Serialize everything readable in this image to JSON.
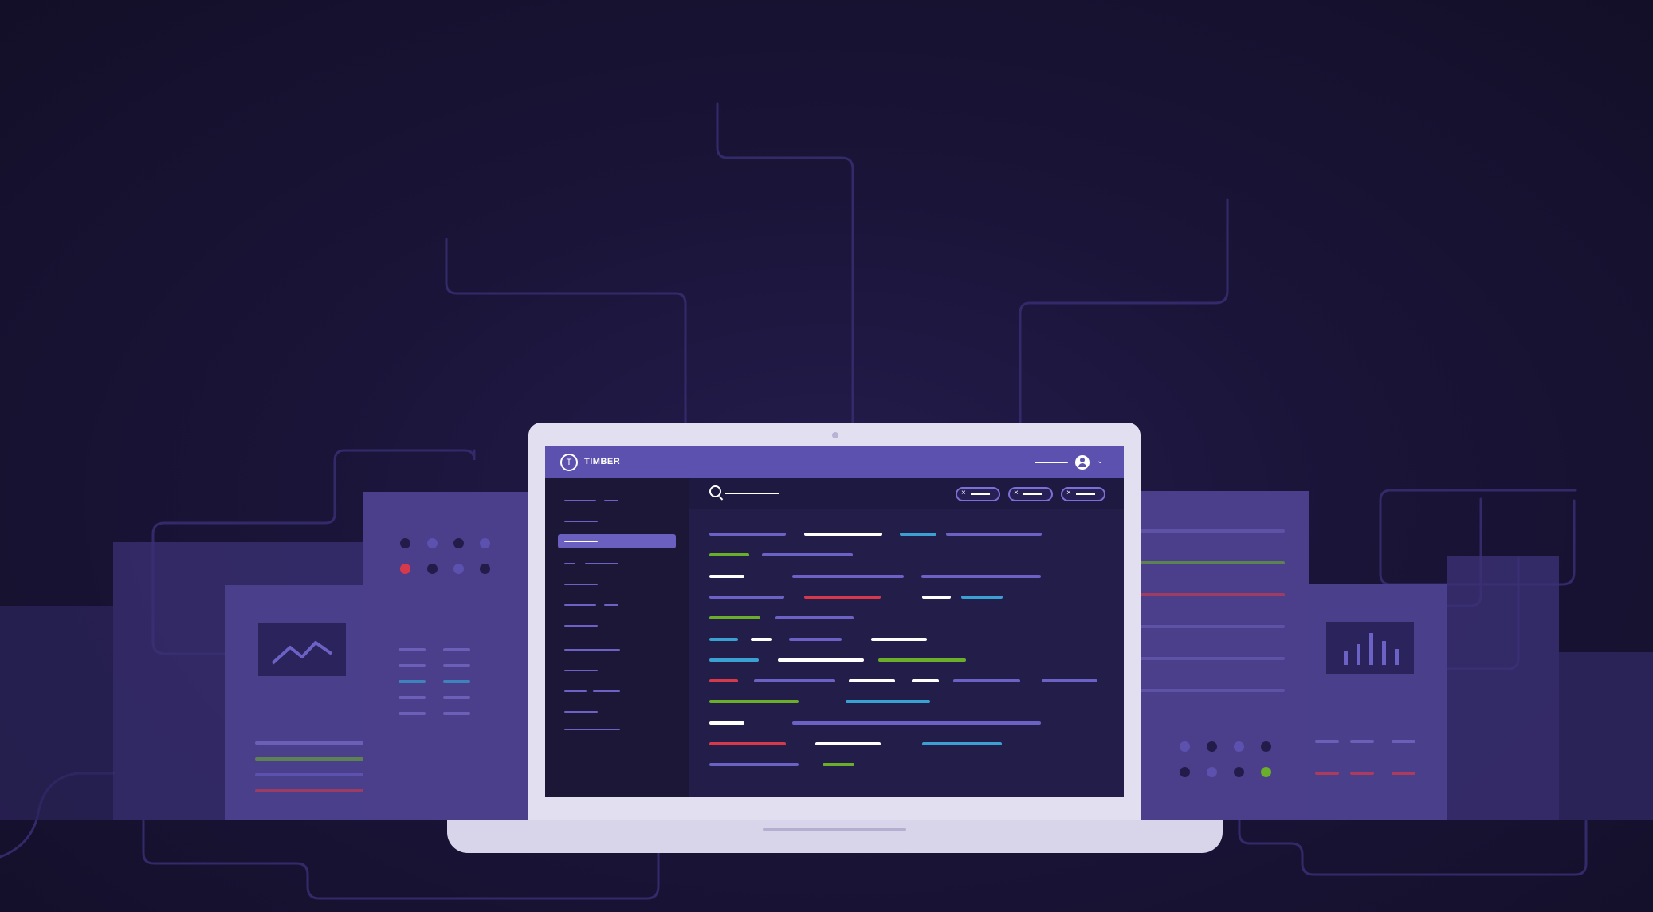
{
  "app": {
    "brand": "TIMBER",
    "logo_glyph": "T"
  },
  "header": {
    "chevron": "⌄"
  },
  "filters": {
    "chip_close": "×"
  },
  "colors": {
    "accent": "#5c51ae",
    "green": "#6aae2a",
    "red": "#d63a4a",
    "blue": "#3aa1d2",
    "white": "#ffffff",
    "purple": "#6c61c4"
  },
  "icons": [
    "logo-icon",
    "avatar-icon",
    "chevron-down-icon",
    "search-icon",
    "close-icon",
    "line-chart-icon",
    "bar-chart-icon"
  ]
}
